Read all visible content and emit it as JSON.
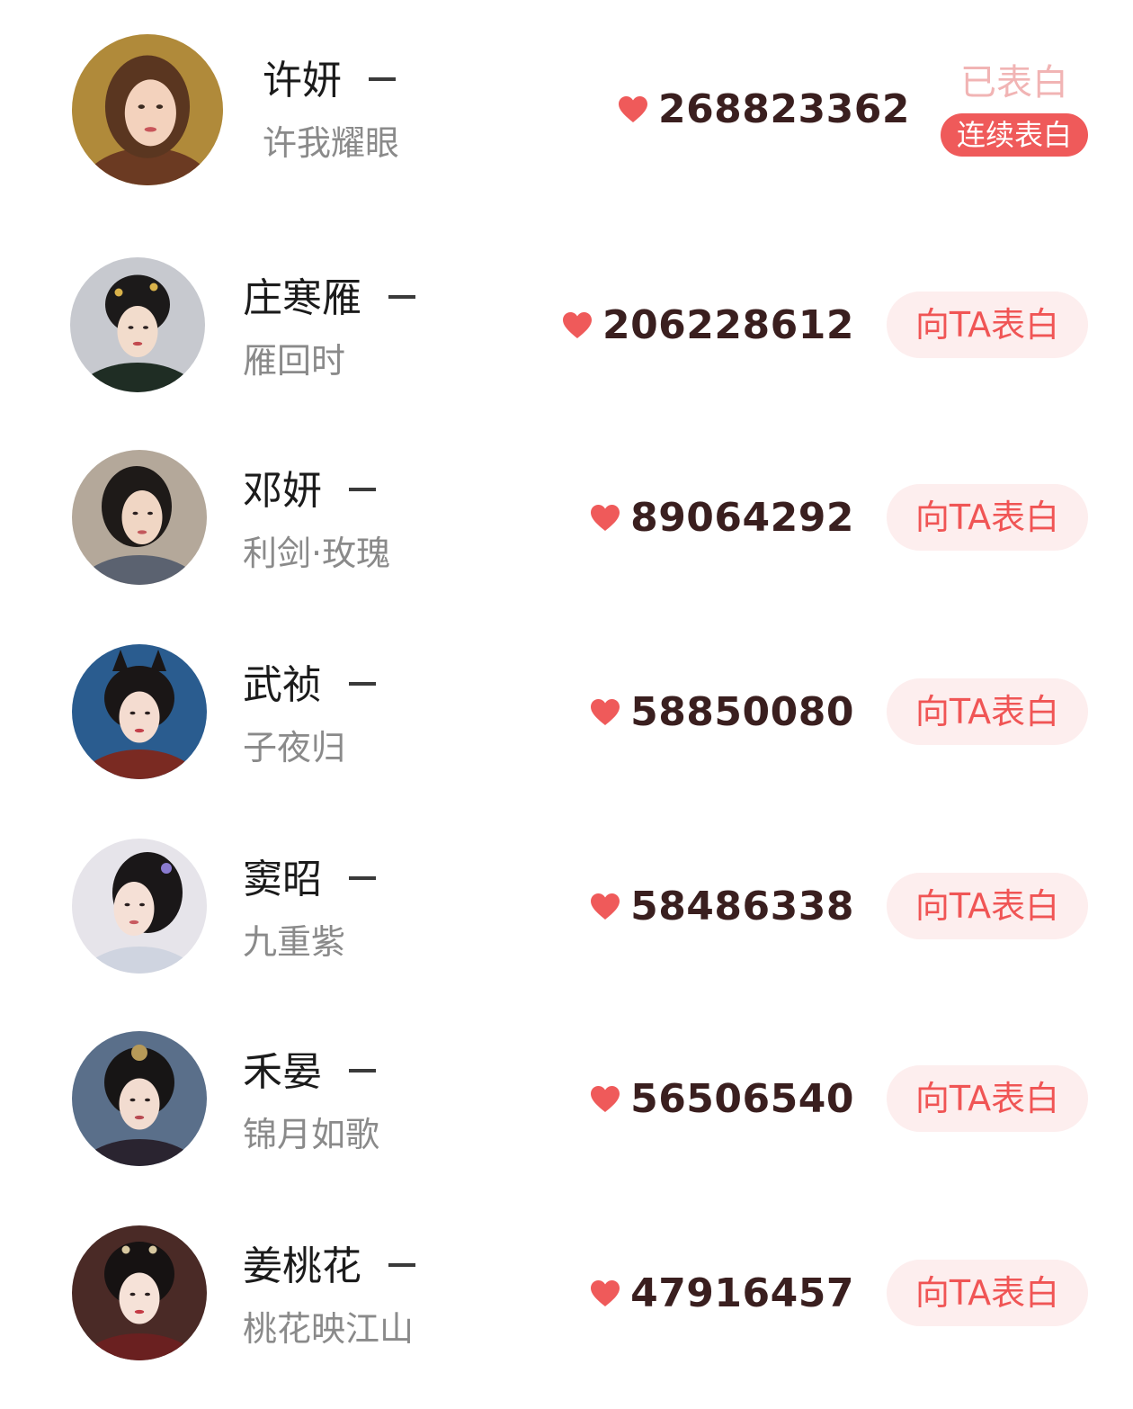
{
  "colors": {
    "accent": "#ef5a5a",
    "button_bg": "#fdeeee",
    "button_text": "#f05555",
    "score_text": "#3a1f1f",
    "name_text": "#1b1b1b",
    "sub_text": "#8a8a8a"
  },
  "first": {
    "name": "许妍",
    "drama": "许我耀眼",
    "score": "268823362",
    "status": "已表白",
    "continue_label": "连续表白"
  },
  "rows": [
    {
      "name": "庄寒雁",
      "drama": "雁回时",
      "score": "206228612",
      "button": "向TA表白"
    },
    {
      "name": "邓妍",
      "drama": "利剑·玫瑰",
      "score": "89064292",
      "button": "向TA表白"
    },
    {
      "name": "武祯",
      "drama": "子夜归",
      "score": "58850080",
      "button": "向TA表白"
    },
    {
      "name": "窦昭",
      "drama": "九重紫",
      "score": "58486338",
      "button": "向TA表白"
    },
    {
      "name": "禾晏",
      "drama": "锦月如歌",
      "score": "56506540",
      "button": "向TA表白"
    },
    {
      "name": "姜桃花",
      "drama": "桃花映江山",
      "score": "47916457",
      "button": "向TA表白"
    }
  ]
}
